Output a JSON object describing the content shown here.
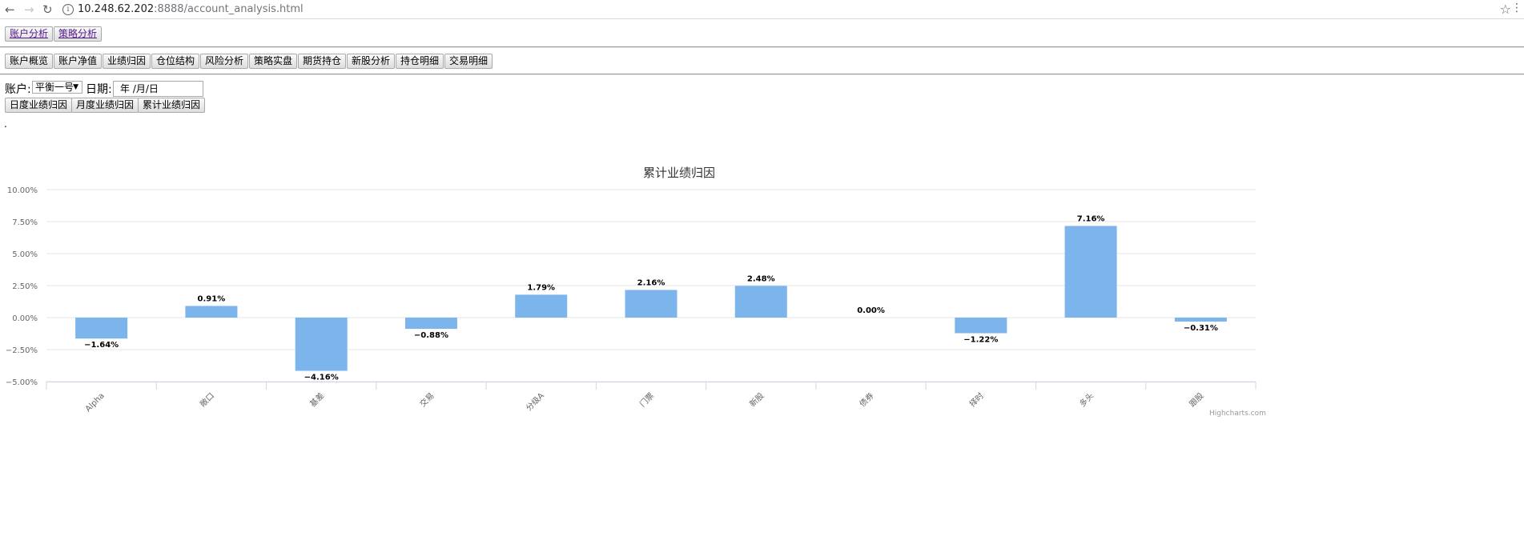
{
  "browser": {
    "url_host": "10.248.62.202",
    "url_rest": ":8888/account_analysis.html"
  },
  "top_nav": [
    "账户分析",
    "策略分析"
  ],
  "sub_nav": [
    "账户概览",
    "账户净值",
    "业绩归因",
    "仓位结构",
    "风险分析",
    "策略实盘",
    "期货持仓",
    "新股分析",
    "持仓明细",
    "交易明细"
  ],
  "filters": {
    "account_label": "账户:",
    "account_value": "平衡一号",
    "date_label": "日期:",
    "date_placeholder": "年 /月/日"
  },
  "attribution_buttons": [
    "日度业绩归因",
    "月度业绩归因",
    "累计业绩归因"
  ],
  "loading_text": ".",
  "credits": "Highcharts.com",
  "chart_data": {
    "type": "bar",
    "title": "累计业绩归因",
    "categories": [
      "Alpha",
      "敞口",
      "基差",
      "交易",
      "分级A",
      "门票",
      "新股",
      "债券",
      "择时",
      "多头",
      "跟股"
    ],
    "values": [
      -1.64,
      0.91,
      -4.16,
      -0.88,
      1.79,
      2.16,
      2.48,
      0.0,
      -1.22,
      7.16,
      -0.31
    ],
    "data_labels": [
      "−1.64%",
      "0.91%",
      "−4.16%",
      "−0.88%",
      "1.79%",
      "2.16%",
      "2.48%",
      "0.00%",
      "−1.22%",
      "7.16%",
      "−0.31%"
    ],
    "ylim": [
      -5,
      10
    ],
    "y_ticks": [
      -5,
      -2.5,
      0,
      2.5,
      5,
      7.5,
      10
    ],
    "y_tick_labels": [
      "−5.00%",
      "−2.50%",
      "0.00%",
      "2.50%",
      "5.00%",
      "7.50%",
      "10.00%"
    ],
    "xlabel": "",
    "ylabel": "",
    "grid": true,
    "legend": false,
    "bar_color": "#7cb5ec"
  }
}
